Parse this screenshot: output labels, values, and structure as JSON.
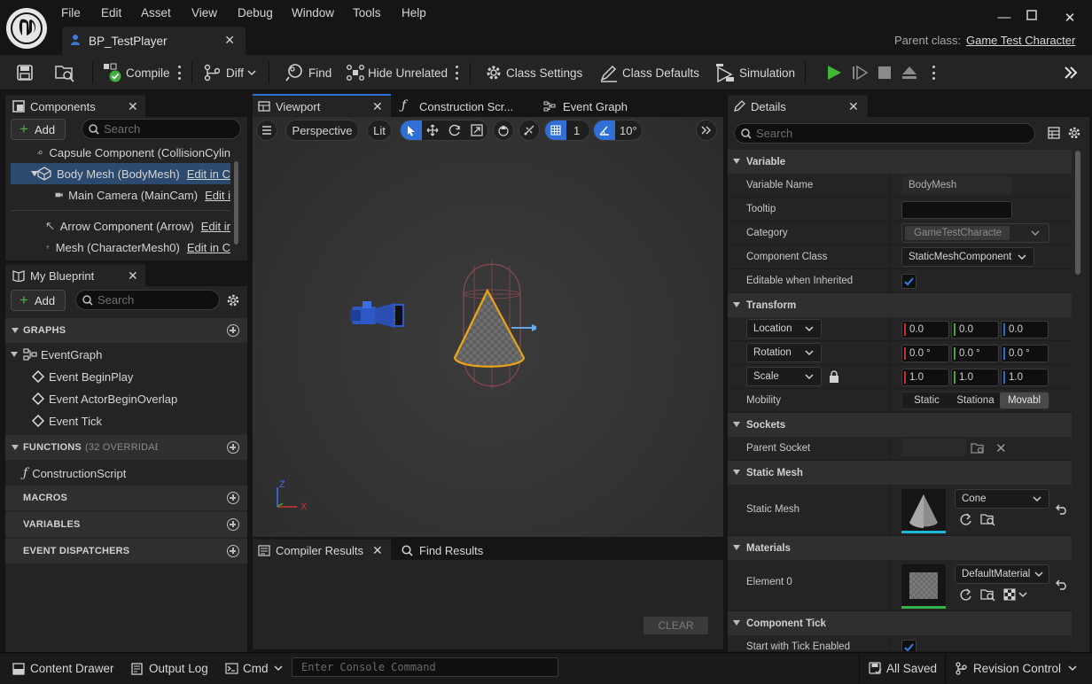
{
  "menu": [
    "File",
    "Edit",
    "Asset",
    "View",
    "Debug",
    "Window",
    "Tools",
    "Help"
  ],
  "document_tab": "BP_TestPlayer",
  "parent_class": {
    "label": "Parent class:",
    "value": "Game Test Character"
  },
  "toolbar": {
    "compile": "Compile",
    "diff": "Diff",
    "find": "Find",
    "hide_unrelated": "Hide Unrelated",
    "class_settings": "Class Settings",
    "class_defaults": "Class Defaults",
    "simulation": "Simulation"
  },
  "components": {
    "tab": "Components",
    "add": "Add",
    "search_placeholder": "Search",
    "items": [
      {
        "label": "Capsule Component (CollisionCylin",
        "link": ""
      },
      {
        "label": "Body Mesh (BodyMesh)",
        "link": "Edit in C"
      },
      {
        "label": "Main Camera (MainCam)",
        "link": "Edit i"
      },
      {
        "label": "Arrow Component (Arrow)",
        "link": "Edit ir"
      },
      {
        "label": "Mesh (CharacterMesh0)",
        "link": "Edit in C"
      }
    ]
  },
  "my_blueprint": {
    "tab": "My Blueprint",
    "add": "Add",
    "search_placeholder": "Search",
    "graphs_header": "GRAPHS",
    "event_graph": "EventGraph",
    "events": [
      "Event BeginPlay",
      "Event ActorBeginOverlap",
      "Event Tick"
    ],
    "functions_header": "FUNCTIONS",
    "functions_note": "(32 OVERRIDABL",
    "construction_script": "ConstructionScript",
    "macros": "MACROS",
    "variables": "VARIABLES",
    "dispatchers": "EVENT DISPATCHERS"
  },
  "center_tabs": [
    "Viewport",
    "Construction Scr...",
    "Event Graph"
  ],
  "viewport": {
    "perspective": "Perspective",
    "lit": "Lit",
    "grid_value": "1",
    "angle_value": "10°",
    "axis_x": "X",
    "axis_z": "Z"
  },
  "bottom_tabs": {
    "compiler": "Compiler Results",
    "find": "Find Results",
    "clear": "CLEAR"
  },
  "details": {
    "tab": "Details",
    "search_placeholder": "Search",
    "variable_header": "Variable",
    "variable_name_label": "Variable Name",
    "variable_name_value": "BodyMesh",
    "tooltip_label": "Tooltip",
    "category_label": "Category",
    "category_value": "GameTestCharacte",
    "component_class_label": "Component Class",
    "component_class_value": "StaticMeshComponent",
    "editable_label": "Editable when Inherited",
    "transform_header": "Transform",
    "location": "Location",
    "rotation": "Rotation",
    "scale": "Scale",
    "location_values": [
      "0.0",
      "0.0",
      "0.0"
    ],
    "rotation_values": [
      "0.0 °",
      "0.0 °",
      "0.0 °"
    ],
    "scale_values": [
      "1.0",
      "1.0",
      "1.0"
    ],
    "mobility_label": "Mobility",
    "mobility_options": [
      "Static",
      "Stationa",
      "Movabl"
    ],
    "sockets_header": "Sockets",
    "parent_socket_label": "Parent Socket",
    "static_mesh_header": "Static Mesh",
    "static_mesh_label": "Static Mesh",
    "static_mesh_value": "Cone",
    "materials_header": "Materials",
    "element0_label": "Element 0",
    "element0_value": "DefaultMaterial",
    "component_tick_header": "Component Tick",
    "start_tick_label": "Start with Tick Enabled"
  },
  "statusbar": {
    "content_drawer": "Content Drawer",
    "output_log": "Output Log",
    "cmd": "Cmd",
    "console_placeholder": "Enter Console Command",
    "all_saved": "All Saved",
    "revision_control": "Revision Control"
  },
  "colors": {
    "accent": "#2f6fd6",
    "compile_ok": "#4bb543",
    "play": "#43b536",
    "selection": "#2c4a6e",
    "orange": "#e8a318"
  }
}
